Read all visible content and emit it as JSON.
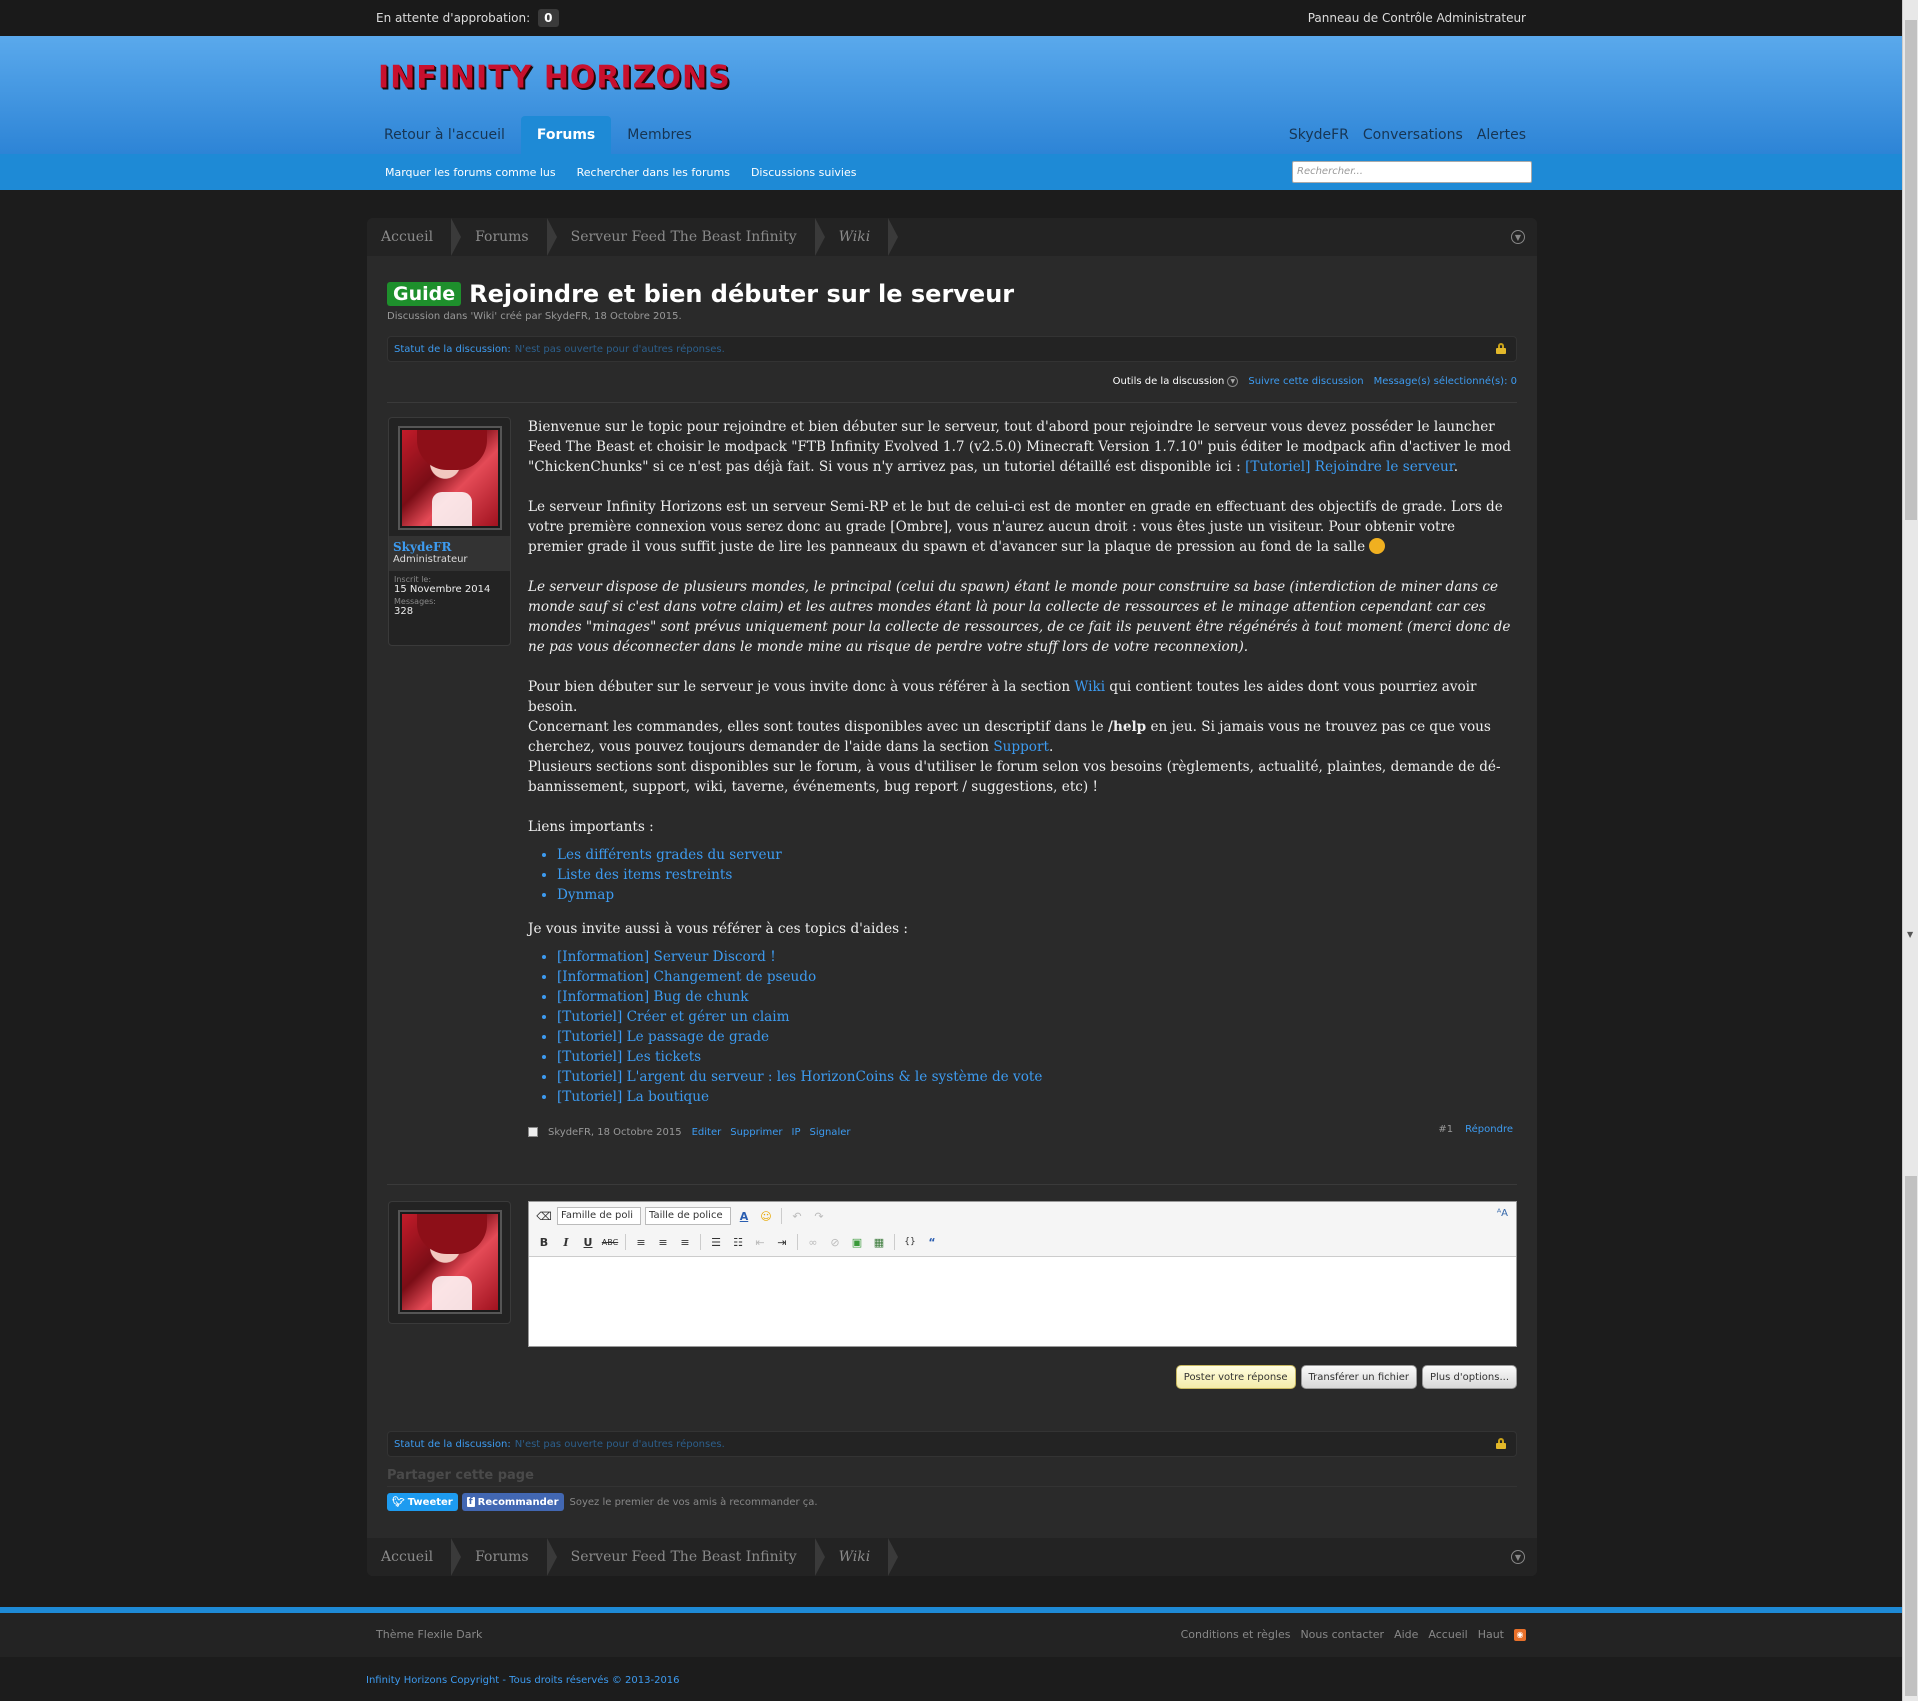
{
  "adminbar": {
    "pending_label": "En attente d'approbation:",
    "pending_count": "0",
    "acp_label": "Panneau de Contrôle Administrateur"
  },
  "header": {
    "logo": "INFINITY HORIZONS",
    "nav_left": [
      "Retour à l'accueil",
      "Forums",
      "Membres"
    ],
    "nav_right": [
      "SkydeFR",
      "Conversations",
      "Alertes"
    ],
    "selected_tab": "Forums"
  },
  "subnav": {
    "links": [
      "Marquer les forums comme lus",
      "Rechercher dans les forums",
      "Discussions suivies"
    ],
    "search_placeholder": "Rechercher..."
  },
  "breadcrumb": [
    "Accueil",
    "Forums",
    "Serveur Feed The Beast Infinity",
    "Wiki"
  ],
  "thread": {
    "prefix": "Guide",
    "title": "Rejoindre et bien débuter sur le serveur",
    "description": "Discussion dans 'Wiki' créé par SkydeFR, 18 Octobre 2015.",
    "status_label": "Statut de la discussion:",
    "status_value": "N'est pas ouverte pour d'autres réponses.",
    "tools_label": "Outils de la discussion",
    "watch_label": "Suivre cette discussion",
    "selected_label": "Message(s) sélectionné(s): 0"
  },
  "user": {
    "name": "SkydeFR",
    "title": "Administrateur",
    "joined_label": "Inscrit le:",
    "joined_value": "15 Novembre 2014",
    "messages_label": "Messages:",
    "messages_value": "328"
  },
  "post": {
    "p1a": "Bienvenue sur le topic pour rejoindre et bien débuter sur le serveur, tout d'abord pour rejoindre le serveur vous devez posséder le launcher Feed The Beast et choisir le modpack \"FTB Infinity Evolved 1.7 (v2.5.0) Minecraft Version 1.7.10\" puis éditer le modpack afin d'activer le mod \"ChickenChunks\" si ce n'est pas déjà fait. Si vous n'y arrivez pas, un tutoriel détaillé est disponible ici : ",
    "p1_link": "[Tutoriel] Rejoindre le serveur",
    "p1b": ".",
    "p2": "Le serveur Infinity Horizons est un serveur Semi-RP et le but de celui-ci est de monter en grade en effectuant des objectifs de grade. Lors de votre première connexion vous serez donc au grade [Ombre], vous n'aurez aucun droit : vous êtes juste un visiteur. Pour obtenir votre premier grade il vous suffit juste de lire les panneaux du spawn et d'avancer sur la plaque de pression au fond de la salle ",
    "p3": "Le serveur dispose de plusieurs mondes, le principal (celui du spawn) étant le monde pour construire sa base (interdiction de miner dans ce monde sauf si c'est dans votre claim) et les autres mondes étant là pour la collecte de ressources et le minage attention cependant car ces mondes \"minages\" sont prévus uniquement pour la collecte de ressources, de ce fait ils peuvent être régénérés à tout moment (merci donc de ne pas vous déconnecter dans le monde mine au risque de perdre votre stuff lors de votre reconnexion).",
    "p4a": "Pour bien débuter sur le serveur je vous invite donc à vous référer à la section ",
    "p4_wiki": "Wiki",
    "p4b": " qui contient toutes les aides dont vous pourriez avoir besoin.",
    "p4c": "Concernant les commandes, elles sont toutes disponibles avec un descriptif dans le ",
    "p4_help": "/help",
    "p4d": " en jeu. Si jamais vous ne trouvez pas ce que vous cherchez, vous pouvez toujours demander de l'aide dans la section ",
    "p4_support": "Support",
    "p4e": ".",
    "p4f": "Plusieurs sections sont disponibles sur le forum, à vous d'utiliser le forum selon vos besoins (règlements, actualité, plaintes, demande de dé-bannissement, support, wiki, taverne, événements, bug report / suggestions, etc) !",
    "links_heading": "Liens importants :",
    "links": [
      "Les différents grades du serveur",
      "Liste des items restreints",
      "Dynmap"
    ],
    "topics_heading": "Je vous invite aussi à vous référer à ces topics d'aides :",
    "topics": [
      "[Information] Serveur Discord !",
      "[Information] Changement de pseudo",
      "[Information] Bug de chunk",
      "[Tutoriel] Créer et gérer un claim",
      "[Tutoriel] Le passage de grade",
      "[Tutoriel] Les tickets",
      "[Tutoriel] L'argent du serveur : les HorizonCoins & le système de vote",
      "[Tutoriel] La boutique"
    ],
    "footer_meta": "SkydeFR, 18 Octobre 2015",
    "controls": [
      "Editer",
      "Supprimer",
      "IP",
      "Signaler"
    ],
    "number": "#1",
    "reply": "Répondre"
  },
  "editor": {
    "font_family": "Famille de poli",
    "font_size": "Taille de police",
    "buttons": [
      "Poster votre réponse",
      "Transférer un fichier",
      "Plus d'options..."
    ]
  },
  "share": {
    "title": "Partager cette page",
    "tweet": "Tweeter",
    "recommend": "Recommander",
    "note": "Soyez le premier de vos amis à recommander ça."
  },
  "footer": {
    "theme": "Thème Flexile Dark",
    "links": [
      "Conditions et règles",
      "Nous contacter",
      "Aide",
      "Accueil",
      "Haut"
    ],
    "copyright": "Infinity Horizons Copyright - Tous droits réservés © 2013-2016"
  },
  "colors": {
    "accent": "#1e8ad6",
    "link": "#3d9bf0",
    "prefix_green": "#1e8f2c",
    "logo_red": "#c8102e"
  }
}
